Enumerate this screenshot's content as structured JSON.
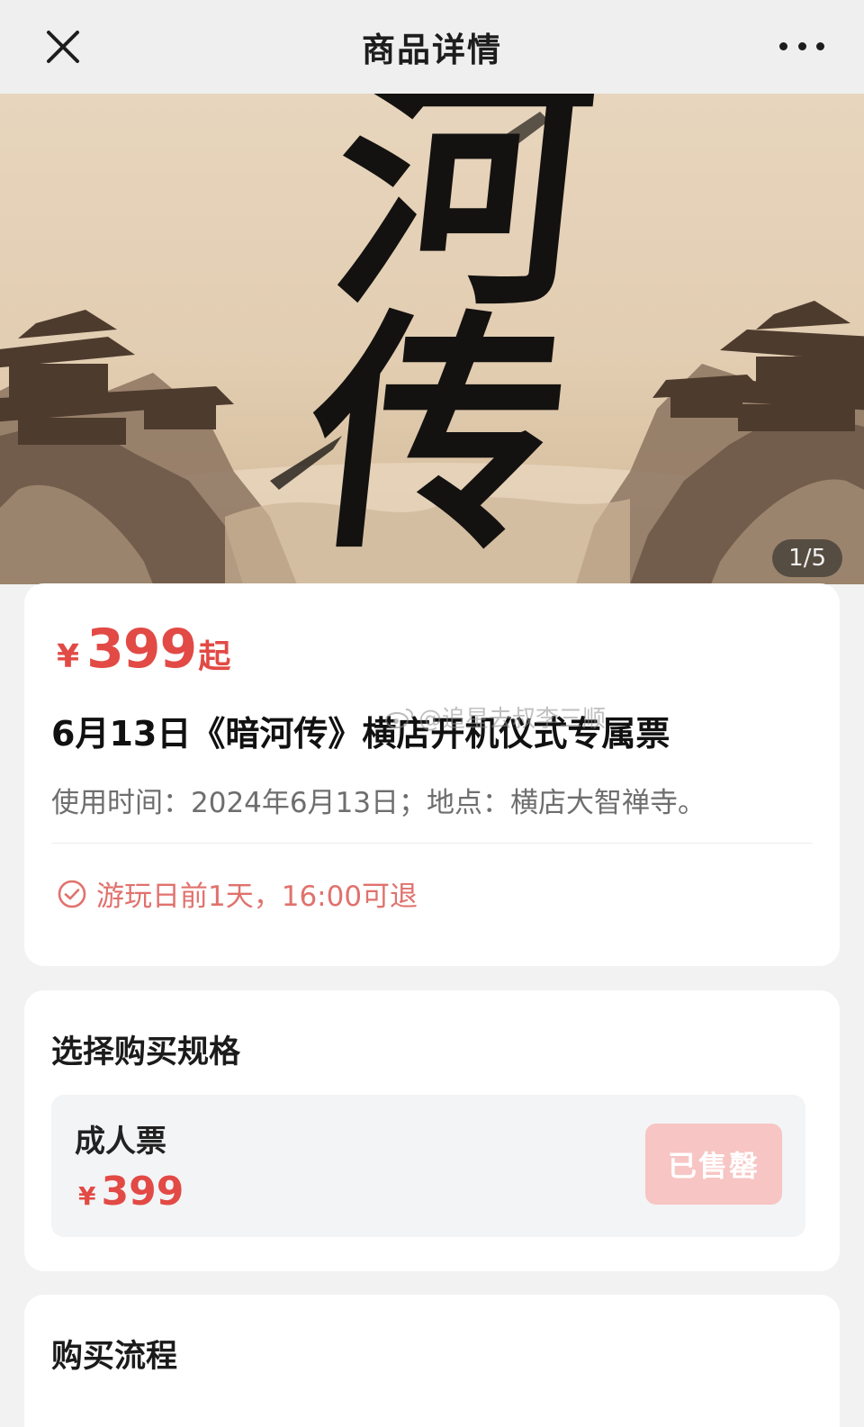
{
  "nav": {
    "title": "商品详情",
    "close_icon": "close-icon",
    "more_icon": "more-icon"
  },
  "banner": {
    "calligraphy_line1": "河",
    "calligraphy_line2": "传",
    "counter": "1/5"
  },
  "product": {
    "price_currency": "¥",
    "price_value": "399",
    "price_suffix": "起",
    "title": "6月13日《暗河传》横店开机仪式专属票",
    "usage_info": "使用时间：2024年6月13日；地点：横店大智禅寺。",
    "refund_policy": "游玩日前1天，16:00可退",
    "refund_icon": "check-circle-icon"
  },
  "watermark": {
    "text": "@追星去叔李三顺",
    "icon": "weibo-icon"
  },
  "spec": {
    "title": "选择购买规格",
    "option_name": "成人票",
    "option_currency": "¥",
    "option_price": "399",
    "button_label": "已售罄"
  },
  "process": {
    "title": "购买流程"
  },
  "colors": {
    "accent": "#e24a45",
    "soldout_button": "#f7c5c3",
    "refund_text": "#e0726d"
  }
}
